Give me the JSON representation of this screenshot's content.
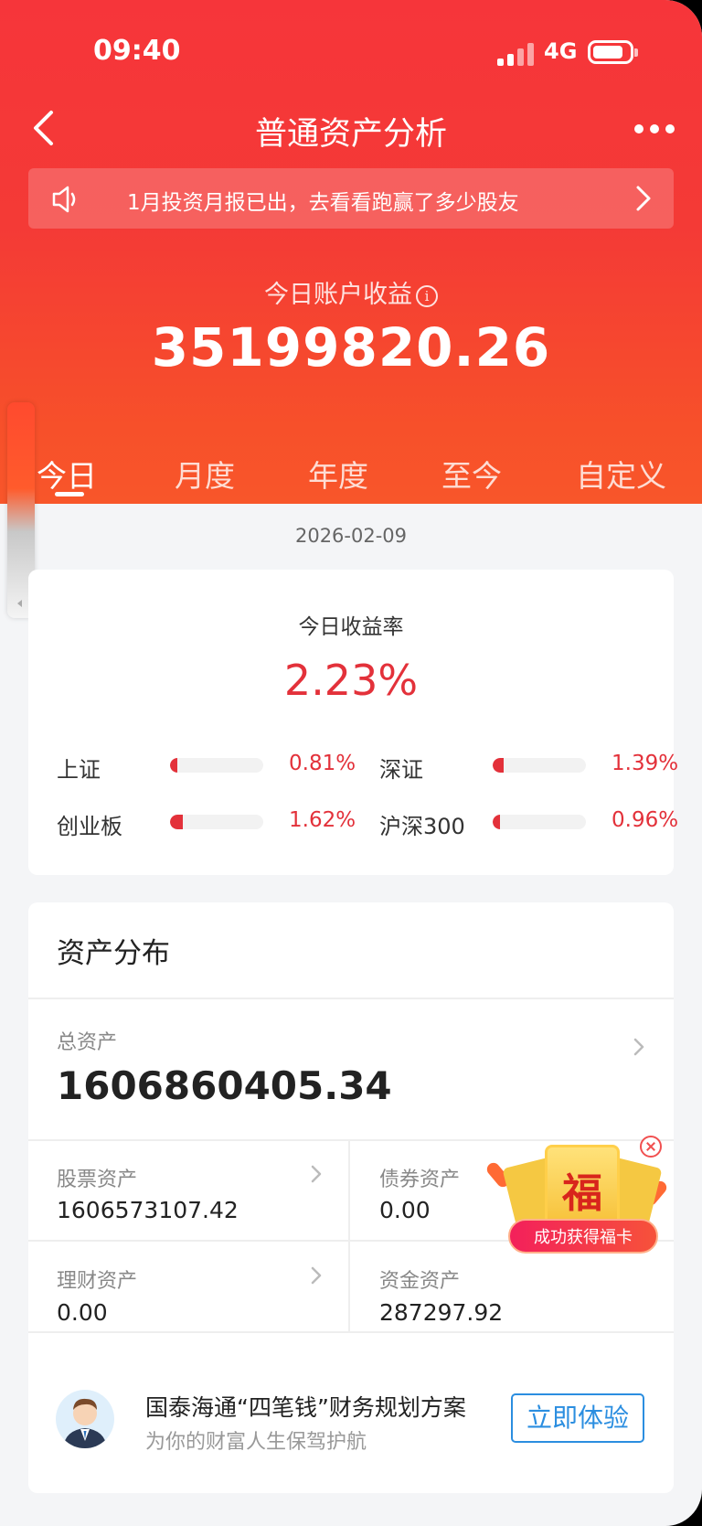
{
  "status": {
    "time": "09:40",
    "network": "4G"
  },
  "nav": {
    "title": "普通资产分析"
  },
  "notice": {
    "text": "1月投资月报已出，去看看跑赢了多少股友"
  },
  "earnings": {
    "label": "今日账户收益",
    "value": "35199820.26"
  },
  "tabs": [
    {
      "label": "今日",
      "active": true
    },
    {
      "label": "月度",
      "active": false
    },
    {
      "label": "年度",
      "active": false
    },
    {
      "label": "至今",
      "active": false
    },
    {
      "label": "自定义",
      "active": false
    }
  ],
  "date": "2026-02-09",
  "rate_card": {
    "label": "今日收益率",
    "value": "2.23%",
    "indices": [
      {
        "name": "上证",
        "pct": "0.81%",
        "level": 0.08
      },
      {
        "name": "深证",
        "pct": "1.39%",
        "level": 0.12
      },
      {
        "name": "创业板",
        "pct": "1.62%",
        "level": 0.14
      },
      {
        "name": "沪深300",
        "pct": "0.96%",
        "level": 0.08
      }
    ]
  },
  "assets": {
    "title": "资产分布",
    "total_label": "总资产",
    "total_value": "1606860405.34",
    "cells": [
      {
        "label": "股票资产",
        "value": "1606573107.42"
      },
      {
        "label": "债券资产",
        "value": "0.00"
      },
      {
        "label": "理财资产",
        "value": "0.00"
      },
      {
        "label": "资金资产",
        "value": "287297.92"
      }
    ]
  },
  "promo": {
    "title": "国泰海通“四笔钱”财务规划方案",
    "subtitle": "为你的财富人生保驾护航",
    "button": "立即体验"
  },
  "fuka": {
    "glyph": "福",
    "banner": "成功获得福卡"
  },
  "colors": {
    "brand_red": "#f43a36",
    "up_red": "#e3313a",
    "link_blue": "#2b8ee0"
  }
}
